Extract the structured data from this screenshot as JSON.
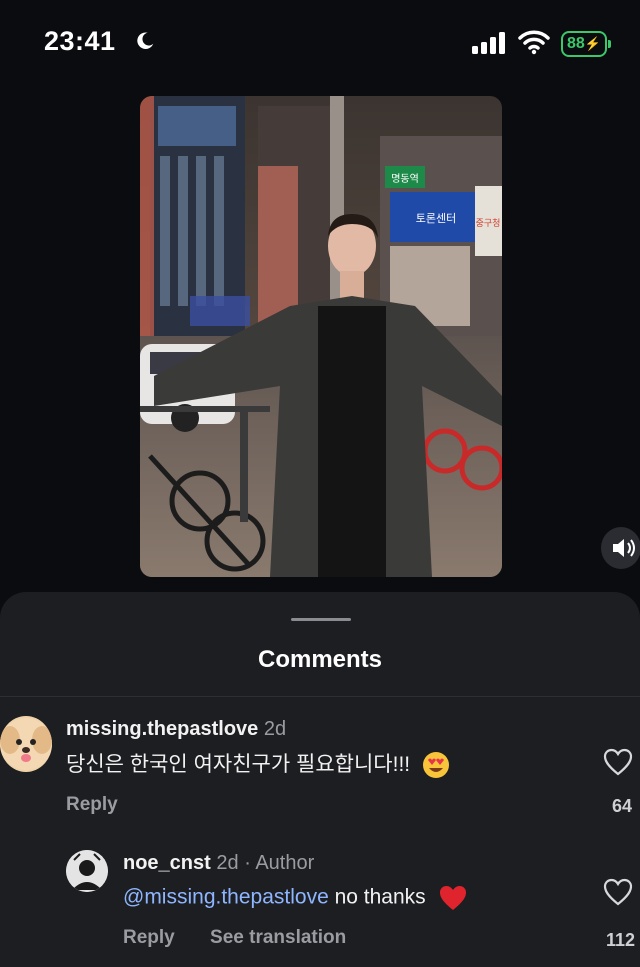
{
  "status_bar": {
    "time": "23:41",
    "battery": "88",
    "icons": [
      "moon-icon",
      "signal-icon",
      "wifi-icon",
      "battery-charging-icon"
    ]
  },
  "video": {
    "sign_text_1": "명동역",
    "sign_text_2": "토론센터",
    "sign_text_3": "중구청"
  },
  "sheet": {
    "title": "Comments"
  },
  "comments": [
    {
      "username": "missing.thepastlove",
      "age": "2d",
      "text": "당신은 한국인 여자친구가 필요합니다!!!",
      "emoji": "heart-eyes-emoji",
      "reply_label": "Reply",
      "likes": "64"
    },
    {
      "username": "noe_cnst",
      "age": "2d",
      "separator": "·",
      "author_label": "Author",
      "mention": "@missing.thepastlove",
      "text": "no thanks",
      "emoji": "red-heart-emoji",
      "reply_label": "Reply",
      "translate_label": "See translation",
      "likes": "112"
    }
  ],
  "colors": {
    "background": "#0b0c10",
    "sheet": "#1d1e22",
    "mention": "#8eb6ff",
    "battery": "#3cc76b",
    "heart": "#e0242d"
  }
}
